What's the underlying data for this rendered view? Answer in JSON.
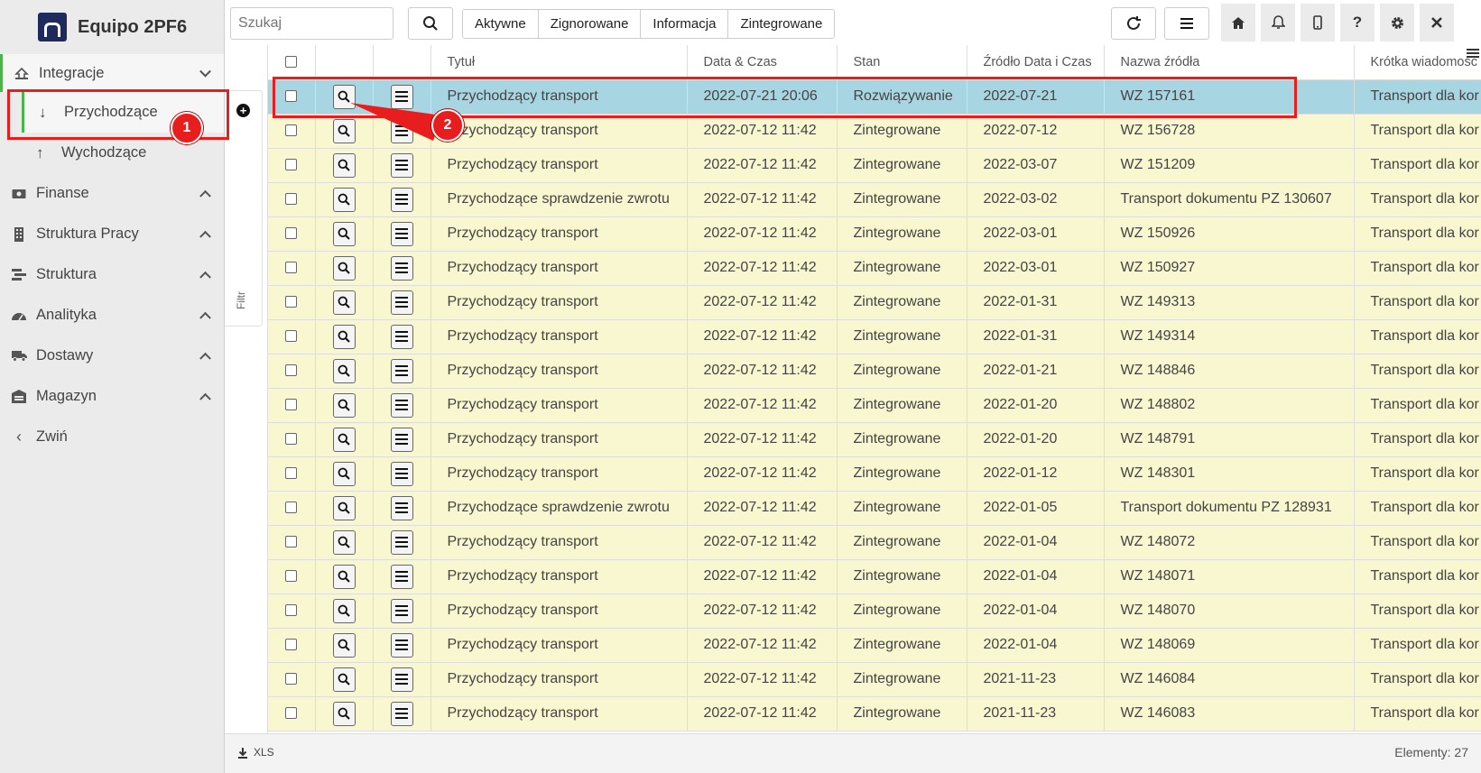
{
  "brand": {
    "name": "Equipo 2PF6"
  },
  "sidebar": {
    "groups": [
      {
        "label": "Integracje",
        "icon": "integration-icon",
        "expanded": true
      },
      {
        "label": "Finanse",
        "icon": "finance-icon"
      },
      {
        "label": "Struktura Pracy",
        "icon": "building-icon"
      },
      {
        "label": "Struktura",
        "icon": "structure-icon"
      },
      {
        "label": "Analityka",
        "icon": "dashboard-icon"
      },
      {
        "label": "Dostawy",
        "icon": "truck-icon"
      },
      {
        "label": "Magazyn",
        "icon": "warehouse-icon"
      }
    ],
    "sub_items": [
      {
        "label": "Przychodzące",
        "selected": true
      },
      {
        "label": "Wychodzące",
        "selected": false
      }
    ],
    "collapse_label": "Zwiń"
  },
  "filter": {
    "label": "Filtr"
  },
  "toolbar": {
    "search_placeholder": "Szukaj",
    "tabs": [
      "Aktywne",
      "Zignorowane",
      "Informacja",
      "Zintegrowane"
    ]
  },
  "table": {
    "headers": [
      "Tytuł",
      "Data & Czas",
      "Stan",
      "Źródło Data i Czas",
      "Nazwa źródła",
      "Krótka wiadomość"
    ],
    "rows": [
      {
        "title": "Przychodzący transport",
        "datetime": "2022-07-21 20:06",
        "state": "Rozwiązywanie",
        "src_date": "2022-07-21",
        "src_name": "WZ 157161",
        "msg": "Transport dla kor"
      },
      {
        "title": "Przychodzący transport",
        "datetime": "2022-07-12 11:42",
        "state": "Zintegrowane",
        "src_date": "2022-07-12",
        "src_name": "WZ 156728",
        "msg": "Transport dla kor"
      },
      {
        "title": "Przychodzący transport",
        "datetime": "2022-07-12 11:42",
        "state": "Zintegrowane",
        "src_date": "2022-03-07",
        "src_name": "WZ 151209",
        "msg": "Transport dla kor"
      },
      {
        "title": "Przychodzące sprawdzenie zwrotu",
        "datetime": "2022-07-12 11:42",
        "state": "Zintegrowane",
        "src_date": "2022-03-02",
        "src_name": "Transport dokumentu PZ 130607",
        "msg": "Transport dla kor"
      },
      {
        "title": "Przychodzący transport",
        "datetime": "2022-07-12 11:42",
        "state": "Zintegrowane",
        "src_date": "2022-03-01",
        "src_name": "WZ 150926",
        "msg": "Transport dla kor"
      },
      {
        "title": "Przychodzący transport",
        "datetime": "2022-07-12 11:42",
        "state": "Zintegrowane",
        "src_date": "2022-03-01",
        "src_name": "WZ 150927",
        "msg": "Transport dla kor"
      },
      {
        "title": "Przychodzący transport",
        "datetime": "2022-07-12 11:42",
        "state": "Zintegrowane",
        "src_date": "2022-01-31",
        "src_name": "WZ 149313",
        "msg": "Transport dla kor"
      },
      {
        "title": "Przychodzący transport",
        "datetime": "2022-07-12 11:42",
        "state": "Zintegrowane",
        "src_date": "2022-01-31",
        "src_name": "WZ 149314",
        "msg": "Transport dla kor"
      },
      {
        "title": "Przychodzący transport",
        "datetime": "2022-07-12 11:42",
        "state": "Zintegrowane",
        "src_date": "2022-01-21",
        "src_name": "WZ 148846",
        "msg": "Transport dla kor"
      },
      {
        "title": "Przychodzący transport",
        "datetime": "2022-07-12 11:42",
        "state": "Zintegrowane",
        "src_date": "2022-01-20",
        "src_name": "WZ 148802",
        "msg": "Transport dla kor"
      },
      {
        "title": "Przychodzący transport",
        "datetime": "2022-07-12 11:42",
        "state": "Zintegrowane",
        "src_date": "2022-01-20",
        "src_name": "WZ 148791",
        "msg": "Transport dla kor"
      },
      {
        "title": "Przychodzący transport",
        "datetime": "2022-07-12 11:42",
        "state": "Zintegrowane",
        "src_date": "2022-01-12",
        "src_name": "WZ 148301",
        "msg": "Transport dla kor"
      },
      {
        "title": "Przychodzące sprawdzenie zwrotu",
        "datetime": "2022-07-12 11:42",
        "state": "Zintegrowane",
        "src_date": "2022-01-05",
        "src_name": "Transport dokumentu PZ 128931",
        "msg": "Transport dla kor"
      },
      {
        "title": "Przychodzący transport",
        "datetime": "2022-07-12 11:42",
        "state": "Zintegrowane",
        "src_date": "2022-01-04",
        "src_name": "WZ 148072",
        "msg": "Transport dla kor"
      },
      {
        "title": "Przychodzący transport",
        "datetime": "2022-07-12 11:42",
        "state": "Zintegrowane",
        "src_date": "2022-01-04",
        "src_name": "WZ 148071",
        "msg": "Transport dla kor"
      },
      {
        "title": "Przychodzący transport",
        "datetime": "2022-07-12 11:42",
        "state": "Zintegrowane",
        "src_date": "2022-01-04",
        "src_name": "WZ 148070",
        "msg": "Transport dla kor"
      },
      {
        "title": "Przychodzący transport",
        "datetime": "2022-07-12 11:42",
        "state": "Zintegrowane",
        "src_date": "2022-01-04",
        "src_name": "WZ 148069",
        "msg": "Transport dla kor"
      },
      {
        "title": "Przychodzący transport",
        "datetime": "2022-07-12 11:42",
        "state": "Zintegrowane",
        "src_date": "2021-11-23",
        "src_name": "WZ 146084",
        "msg": "Transport dla kor"
      },
      {
        "title": "Przychodzący transport",
        "datetime": "2022-07-12 11:42",
        "state": "Zintegrowane",
        "src_date": "2021-11-23",
        "src_name": "WZ 146083",
        "msg": "Transport dla kor"
      }
    ]
  },
  "footer": {
    "export_label": "XLS",
    "count_label": "Elementy:",
    "count_value": "27"
  },
  "annotations": [
    {
      "number": "1"
    },
    {
      "number": "2"
    }
  ],
  "colors": {
    "accent": "#4db34d",
    "row_bg": "#f8f7d0",
    "row_selected": "#a8d5e2",
    "annotation": "#e81e1e",
    "brand": "#1f2a5c"
  }
}
